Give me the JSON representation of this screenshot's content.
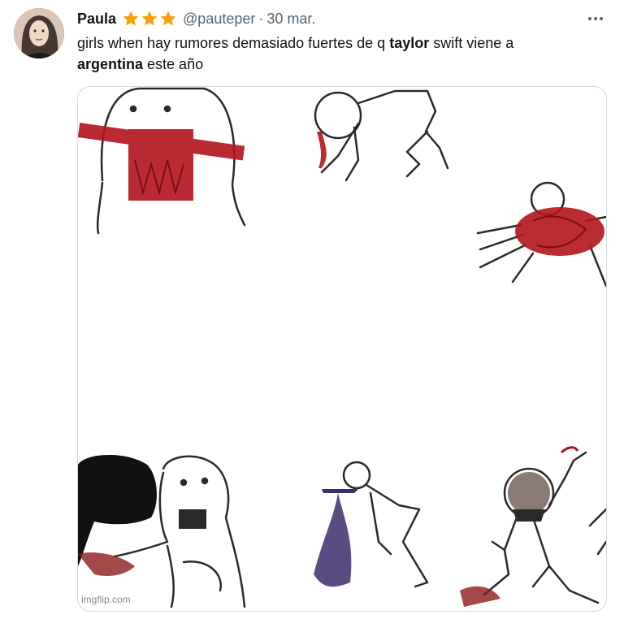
{
  "tweet": {
    "author_name": "Paula",
    "stars_count": 3,
    "handle": "@pauteper",
    "separator": "·",
    "date": "30 mar.",
    "text_parts": {
      "p1": "girls when hay rumores demasiado fuertes de q ",
      "taylor": "taylor",
      "p2": " swift viene a ",
      "argentina": "argentina",
      "p3": " este año"
    }
  },
  "media": {
    "watermark": "imgflip.com"
  },
  "colors": {
    "star": "#f7a10c",
    "blood": "#b3141c",
    "muted": "#536471",
    "border": "#cfd9de"
  },
  "icons": {
    "more": "more-horizontal-icon",
    "star": "star-icon"
  }
}
